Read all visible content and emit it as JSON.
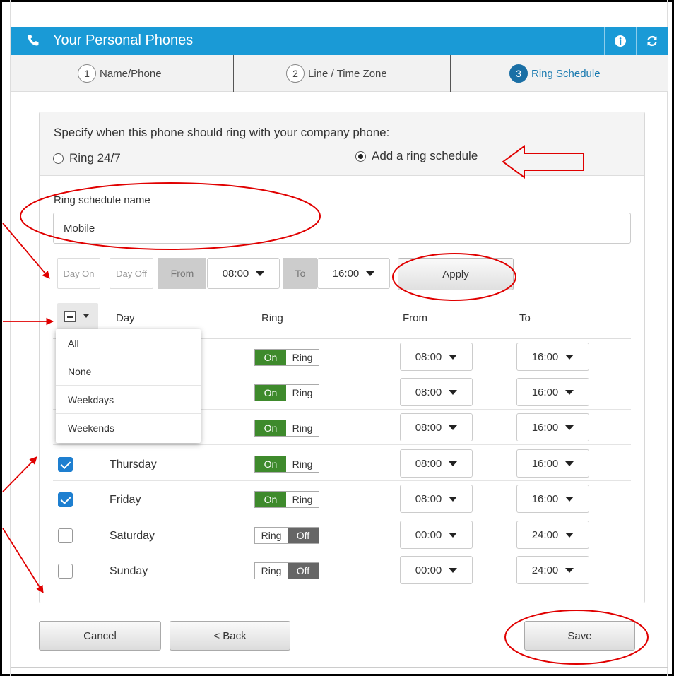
{
  "header": {
    "title": "Your Personal Phones",
    "icons": [
      "phone-icon",
      "info-icon",
      "refresh-icon"
    ]
  },
  "steps": [
    {
      "num": "1",
      "label": "Name/Phone"
    },
    {
      "num": "2",
      "label": "Line / Time Zone"
    },
    {
      "num": "3",
      "label": "Ring Schedule"
    }
  ],
  "ring": {
    "prompt": "Specify when this phone should ring with your company phone:",
    "opt_247": "Ring 24/7",
    "opt_schedule": "Add a ring schedule",
    "selected": "opt_schedule"
  },
  "schedule": {
    "name_label": "Ring schedule name",
    "name_value": "Mobile"
  },
  "toolbar": {
    "day_on": "Day On",
    "day_off": "Day Off",
    "from_label": "From",
    "from_value": "08:00",
    "to_label": "To",
    "to_value": "16:00",
    "apply": "Apply"
  },
  "table": {
    "headers": {
      "day": "Day",
      "ring": "Ring",
      "from": "From",
      "to": "To"
    },
    "rows": [
      {
        "day": "",
        "checked": true,
        "on": "On",
        "ring": "Ring",
        "from": "08:00",
        "to": "16:00"
      },
      {
        "day": "",
        "checked": true,
        "on": "On",
        "ring": "Ring",
        "from": "08:00",
        "to": "16:00"
      },
      {
        "day": "",
        "checked": true,
        "on": "On",
        "ring": "Ring",
        "from": "08:00",
        "to": "16:00"
      },
      {
        "day": "Thursday",
        "checked": true,
        "on": "On",
        "ring": "Ring",
        "from": "08:00",
        "to": "16:00"
      },
      {
        "day": "Friday",
        "checked": true,
        "on": "On",
        "ring": "Ring",
        "from": "08:00",
        "to": "16:00"
      },
      {
        "day": "Saturday",
        "checked": false,
        "ring": "Ring",
        "off": "Off",
        "from": "00:00",
        "to": "24:00"
      },
      {
        "day": "Sunday",
        "checked": false,
        "ring": "Ring",
        "off": "Off",
        "from": "00:00",
        "to": "24:00"
      }
    ]
  },
  "dropdown": {
    "items": [
      "All",
      "None",
      "Weekdays",
      "Weekends"
    ]
  },
  "footer": {
    "cancel": "Cancel",
    "back": "< Back",
    "save": "Save"
  },
  "colors": {
    "header_bg": "#1a9ad6",
    "on_green": "#3e8a2c",
    "off_gray": "#666666",
    "annotation_red": "#e00000",
    "active_step": "#1a6fa5"
  }
}
